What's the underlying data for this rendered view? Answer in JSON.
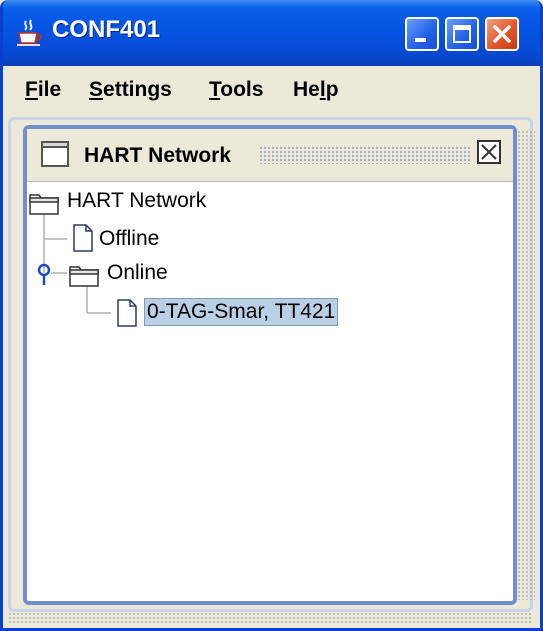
{
  "window": {
    "title": "CONF401"
  },
  "menubar": {
    "items": [
      {
        "label": "File",
        "mnemonic": "F",
        "rest": "ile"
      },
      {
        "label": "Settings",
        "mnemonic": "S",
        "rest": "ettings"
      },
      {
        "label": "Tools",
        "mnemonic": "T",
        "rest": "ools"
      },
      {
        "label": "Help",
        "pre": "He",
        "mnemonic": "l",
        "rest": "p"
      }
    ]
  },
  "panel": {
    "title": "HART Network"
  },
  "tree": {
    "root": "HART Network",
    "offline": "Offline",
    "online": "Online",
    "device": "0-TAG-Smar, TT421"
  },
  "icons": {
    "app": "java-cup-icon",
    "minimize": "minimize-icon",
    "maximize": "maximize-icon",
    "close": "close-icon",
    "folder": "folder-icon",
    "document": "document-icon"
  },
  "colors": {
    "titlebar": "#0553e1",
    "close_button": "#e2582c",
    "selection": "#b8cfe5",
    "panel_border": "#6f8fcf"
  }
}
